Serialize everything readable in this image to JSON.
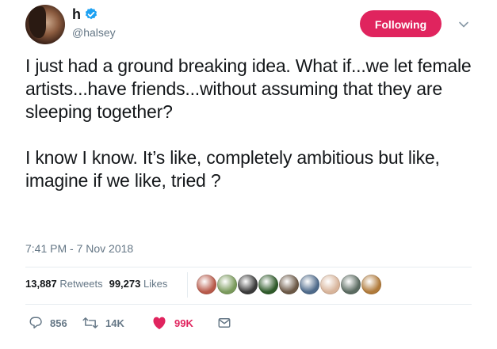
{
  "author": {
    "display_name": "h",
    "handle": "@halsey",
    "verified": true
  },
  "follow_button": {
    "label": "Following",
    "color": "#e0245e"
  },
  "tweet": {
    "paragraphs": [
      "I just had a ground breaking idea. What if...we let female artists...have friends...without assuming that they are sleeping together?",
      "I know I know. It’s like, completely ambitious but like, imagine if we like, tried ?"
    ],
    "timestamp": "7:41 PM - 7 Nov 2018"
  },
  "stats": {
    "retweets_count": "13,887",
    "retweets_label": "Retweets",
    "likes_count": "99,273",
    "likes_label": "Likes"
  },
  "liker_avatars": [
    "#b85a4a",
    "#7a9a5c",
    "#3a3a3a",
    "#2f5a2a",
    "#6b5846",
    "#4e6a8a",
    "#d8b49a",
    "#5a6a60",
    "#b07a3a"
  ],
  "actions": {
    "replies": "856",
    "retweets": "14K",
    "likes": "99K"
  },
  "colors": {
    "accent": "#e0245e",
    "verified_blue": "#1da1f2",
    "muted_text": "#657786"
  },
  "icons": [
    "verified-badge-icon",
    "chevron-down-icon",
    "reply-icon",
    "retweet-icon",
    "heart-icon",
    "direct-message-icon"
  ]
}
